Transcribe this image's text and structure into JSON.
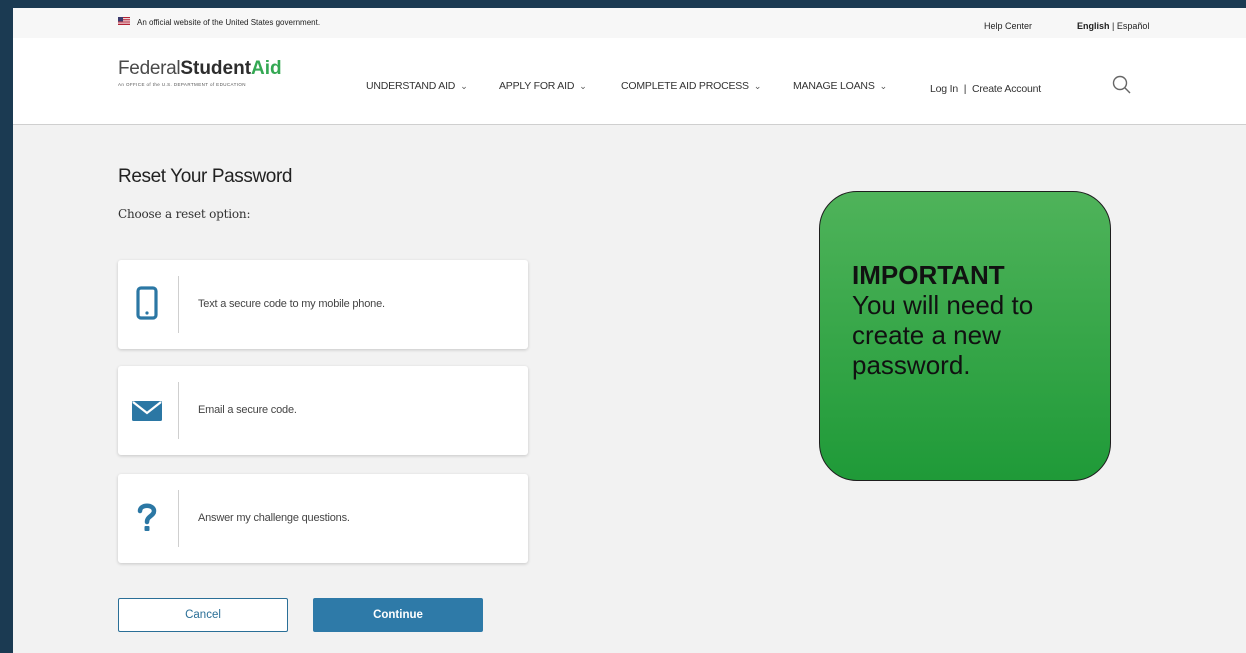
{
  "gov_banner": {
    "official_text": "An official website of the United States government.",
    "help_center": "Help Center",
    "lang_english": "English",
    "lang_sep": " | ",
    "lang_spanish": "Español"
  },
  "logo": {
    "federal": "Federal",
    "student": "Student",
    "aid": "Aid",
    "subtitle": "An OFFICE of the U.S. DEPARTMENT of EDUCATION"
  },
  "nav": {
    "items": [
      {
        "label": "UNDERSTAND AID"
      },
      {
        "label": "APPLY FOR AID"
      },
      {
        "label": "COMPLETE AID PROCESS"
      },
      {
        "label": "MANAGE LOANS"
      }
    ],
    "login": "Log In",
    "login_sep": "|",
    "create_account": "Create Account"
  },
  "main": {
    "title": "Reset Your Password",
    "subtitle": "Choose a reset option:",
    "options": [
      {
        "icon": "mobile-phone-icon",
        "label": "Text a secure code to my mobile phone."
      },
      {
        "icon": "envelope-icon",
        "label": "Email a secure code."
      },
      {
        "icon": "question-mark-icon",
        "label": "Answer my challenge questions."
      }
    ],
    "cancel_label": "Cancel",
    "continue_label": "Continue"
  },
  "callout": {
    "heading": "IMPORTANT",
    "body": "You will need to create a new password."
  },
  "colors": {
    "accent_blue": "#2e7aa8",
    "icon_blue": "#2b77a4",
    "logo_green": "#34a853",
    "callout_green": "#35a447",
    "frame_dark": "#1b3a52"
  }
}
